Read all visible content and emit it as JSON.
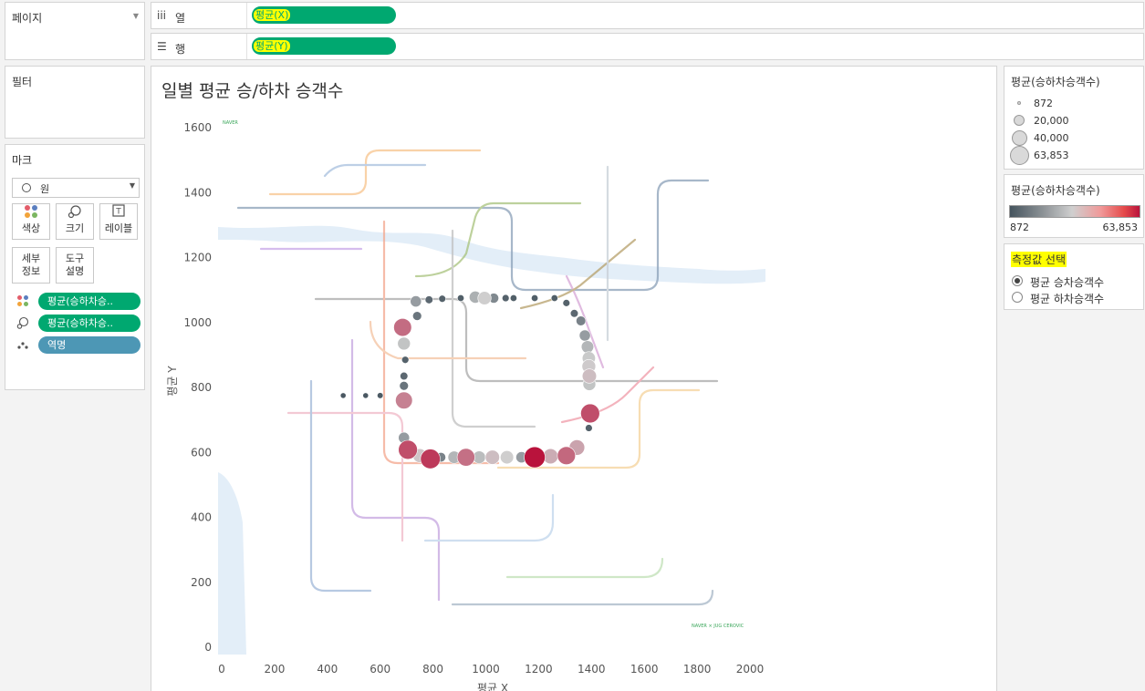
{
  "pages": {
    "title": "페이지"
  },
  "shelves": {
    "columns": {
      "label": "열",
      "pill": "평균(X)"
    },
    "rows": {
      "label": "행",
      "pill": "평균(Y)"
    }
  },
  "filters": {
    "title": "필터"
  },
  "marks": {
    "title": "마크",
    "mark_type": "원",
    "buttons": {
      "color": "색상",
      "size": "크기",
      "label": "레이블",
      "detail": "세부\n정보",
      "tooltip": "도구\n설명"
    },
    "fields": {
      "color": "평균(승하차승..",
      "size": "평균(승하차승..",
      "detail": "역명"
    }
  },
  "chart": {
    "title": "일별 평균 승/하차 승객수"
  },
  "chart_data": {
    "type": "scatter",
    "title": "일별 평균 승/하차 승객수",
    "xlabel": "평균 X",
    "ylabel": "평균 Y",
    "xlim": [
      0,
      2050
    ],
    "ylim": [
      -20,
      1640
    ],
    "x_ticks": [
      0,
      200,
      400,
      600,
      800,
      1000,
      1200,
      1400,
      1600,
      1800,
      2000
    ],
    "y_ticks": [
      0,
      200,
      400,
      600,
      800,
      1000,
      1200,
      1400,
      1600
    ],
    "background_image": "seoul-subway-map",
    "map_credit_top": "NAVER",
    "map_credit_bottom": "NAVER × JUG CEROVIC",
    "color_scale": {
      "min": 872,
      "max": 63853,
      "low": "#45545e",
      "mid": "#cfcfcf",
      "high": "#b9133c"
    },
    "points": [
      {
        "x": 735,
        "y": 1065,
        "v": 12000
      },
      {
        "x": 740,
        "y": 1020,
        "v": 6000
      },
      {
        "x": 785,
        "y": 1070,
        "v": 4000
      },
      {
        "x": 835,
        "y": 1073,
        "v": 3000
      },
      {
        "x": 905,
        "y": 1075,
        "v": 2500
      },
      {
        "x": 960,
        "y": 1078,
        "v": 15000
      },
      {
        "x": 995,
        "y": 1075,
        "v": 20000
      },
      {
        "x": 1030,
        "y": 1075,
        "v": 9000
      },
      {
        "x": 1075,
        "y": 1075,
        "v": 3000
      },
      {
        "x": 1105,
        "y": 1075,
        "v": 2500
      },
      {
        "x": 1185,
        "y": 1075,
        "v": 2500
      },
      {
        "x": 1260,
        "y": 1075,
        "v": 2500
      },
      {
        "x": 1305,
        "y": 1060,
        "v": 3000
      },
      {
        "x": 1335,
        "y": 1028,
        "v": 4000
      },
      {
        "x": 1360,
        "y": 1005,
        "v": 8000
      },
      {
        "x": 1375,
        "y": 960,
        "v": 12000
      },
      {
        "x": 1385,
        "y": 925,
        "v": 16000
      },
      {
        "x": 1390,
        "y": 890,
        "v": 19000
      },
      {
        "x": 1390,
        "y": 865,
        "v": 21000
      },
      {
        "x": 1392,
        "y": 835,
        "v": 24000
      },
      {
        "x": 1392,
        "y": 810,
        "v": 18000
      },
      {
        "x": 1395,
        "y": 720,
        "v": 50000
      },
      {
        "x": 1390,
        "y": 675,
        "v": 3000
      },
      {
        "x": 1345,
        "y": 615,
        "v": 30000
      },
      {
        "x": 1305,
        "y": 590,
        "v": 44000
      },
      {
        "x": 1245,
        "y": 588,
        "v": 28000
      },
      {
        "x": 1185,
        "y": 585,
        "v": 63853
      },
      {
        "x": 1135,
        "y": 585,
        "v": 12000
      },
      {
        "x": 1080,
        "y": 585,
        "v": 20000
      },
      {
        "x": 1025,
        "y": 585,
        "v": 24000
      },
      {
        "x": 975,
        "y": 585,
        "v": 17000
      },
      {
        "x": 925,
        "y": 585,
        "v": 42000
      },
      {
        "x": 880,
        "y": 585,
        "v": 16000
      },
      {
        "x": 830,
        "y": 585,
        "v": 8000
      },
      {
        "x": 790,
        "y": 580,
        "v": 55000
      },
      {
        "x": 750,
        "y": 590,
        "v": 22000
      },
      {
        "x": 705,
        "y": 608,
        "v": 50000
      },
      {
        "x": 690,
        "y": 645,
        "v": 12000
      },
      {
        "x": 690,
        "y": 760,
        "v": 38000
      },
      {
        "x": 690,
        "y": 805,
        "v": 6000
      },
      {
        "x": 690,
        "y": 835,
        "v": 4000
      },
      {
        "x": 695,
        "y": 885,
        "v": 3000
      },
      {
        "x": 690,
        "y": 935,
        "v": 18000
      },
      {
        "x": 685,
        "y": 985,
        "v": 43000
      },
      {
        "x": 460,
        "y": 775,
        "v": 1500
      },
      {
        "x": 545,
        "y": 775,
        "v": 1500
      },
      {
        "x": 600,
        "y": 775,
        "v": 1800
      }
    ]
  },
  "size_legend": {
    "title": "평균(승하차승객수)",
    "items": [
      {
        "label": "872"
      },
      {
        "label": "20,000"
      },
      {
        "label": "40,000"
      },
      {
        "label": "63,853"
      }
    ]
  },
  "color_legend": {
    "title": "평균(승하차승객수)",
    "min": "872",
    "max": "63,853"
  },
  "parameter": {
    "title": "측정값 선택",
    "options": [
      {
        "label": "평균 승차승객수",
        "selected": true
      },
      {
        "label": "평균 하차승객수",
        "selected": false
      }
    ]
  }
}
